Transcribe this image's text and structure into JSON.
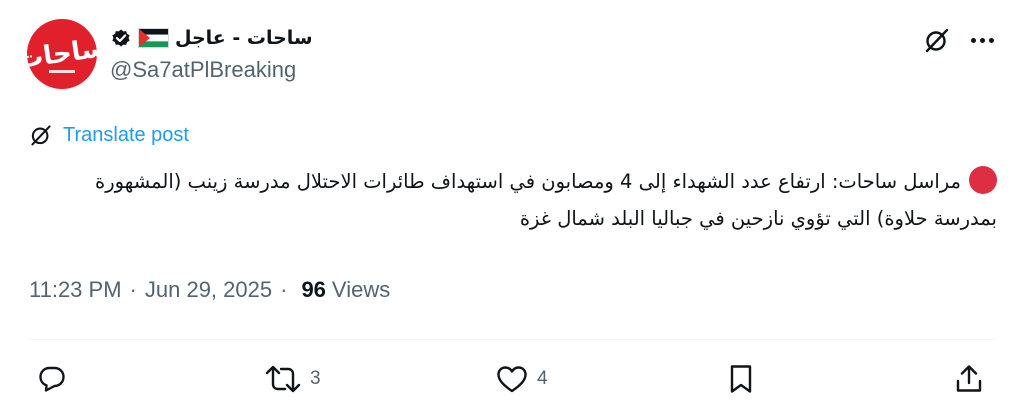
{
  "author": {
    "display_name": "ساحات - عاجل",
    "handle": "@Sa7atPlBreaking",
    "avatar_text": "ساحات",
    "verified_icon": "verified-badge-icon",
    "flag_icon": "palestine-flag-icon"
  },
  "top_actions": {
    "grok_icon": "grok-icon",
    "more_icon": "more-options-icon"
  },
  "translate": {
    "label": "Translate post"
  },
  "tweet": {
    "text": "مراسل ساحات: ارتفاع عدد الشهداء إلى 4 ومصابون في استهداف طائرات الاحتلال مدرسة زينب (المشهورة بمدرسة حلاوة) التي تؤوي نازحين في جباليا البلد شمال غزة"
  },
  "meta": {
    "time": "11:23 PM",
    "date": "Jun 29, 2025",
    "separator": "·",
    "views_count": "96",
    "views_label": "Views"
  },
  "actions": {
    "reply_count": "",
    "retweet_count": "3",
    "like_count": "4"
  },
  "colors": {
    "accent": "#1d9bf0",
    "avatar_bg": "#e0202b",
    "secondary_text": "#536471",
    "primary_text": "#0f1419"
  }
}
